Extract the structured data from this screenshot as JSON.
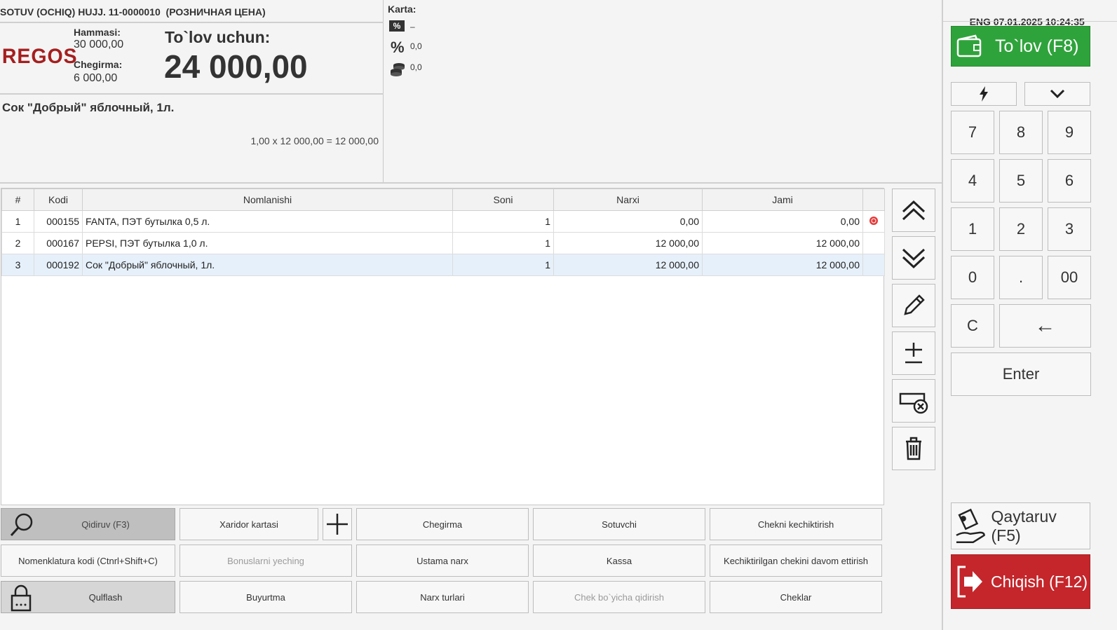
{
  "header": {
    "doc_title": "SOTUV (OCHIQ) HUJJ. 11-0000010  (РОЗНИЧНАЯ ЦЕНА)",
    "logo_text": "REGOS",
    "total_label": "Hammasi:",
    "total_value": "30 000,00",
    "discount_label": "Chegirma:",
    "discount_value": "6 000,00",
    "pay_label": "To`lov uchun:",
    "pay_value": "24 000,00"
  },
  "card": {
    "label": "Karta:",
    "card_value": "–",
    "percent_value": "0,0",
    "coins_value": "0,0"
  },
  "current_item": {
    "name": "Сок \"Добрый\" яблочный, 1л.",
    "calc": "1,00 x 12 000,00 = 12 000,00"
  },
  "status": {
    "lang": "ENG",
    "datetime": "07.01.2025 10:24:35"
  },
  "table": {
    "columns": [
      "#",
      "Kodi",
      "Nomlanishi",
      "Soni",
      "Narxi",
      "Jami"
    ],
    "rows": [
      {
        "n": "1",
        "code": "000155",
        "name": "FANTA, ПЭТ бутылка 0,5 л.",
        "qty": "1",
        "price": "0,00",
        "total": "0,00",
        "flag": true
      },
      {
        "n": "2",
        "code": "000167",
        "name": "PEPSI, ПЭТ бутылка 1,0 л.",
        "qty": "1",
        "price": "12 000,00",
        "total": "12 000,00",
        "flag": false
      },
      {
        "n": "3",
        "code": "000192",
        "name": "Сок \"Добрый\" яблочный, 1л.",
        "qty": "1",
        "price": "12 000,00",
        "total": "12 000,00",
        "flag": false
      }
    ]
  },
  "buttons": {
    "search": "Qidiruv (F3)",
    "customer_card": "Xaridor kartasi",
    "discount": "Chegirma",
    "seller": "Sotuvchi",
    "delay_check": "Chekni kechiktirish",
    "nomenclature": "Nomenklatura kodi (Ctnrl+Shift+C)",
    "bonus": "Bonuslarni yeching",
    "master_price": "Ustama narx",
    "cashbox": "Kassa",
    "continue_delayed": "Kechiktirilgan chekini davom ettirish",
    "lock": "Qulflash",
    "order": "Buyurtma",
    "price_types": "Narx turlari",
    "check_search": "Chek bo`yicha qidirish",
    "checks": "Cheklar"
  },
  "keypad": {
    "pay": "To`lov (F8)",
    "keys": [
      "7",
      "8",
      "9",
      "4",
      "5",
      "6",
      "1",
      "2",
      "3",
      "0",
      ".",
      "00"
    ],
    "clear": "C",
    "backspace": "←",
    "enter": "Enter",
    "return": "Qaytaruv (F5)",
    "exit": "Chiqish (F12)"
  },
  "colors": {
    "pay_green": "#2fa33b",
    "exit_red": "#c4262b",
    "logo_red": "#a51f1f",
    "selected_row": "#e6f0fa",
    "flag_red": "#e33b3b"
  }
}
